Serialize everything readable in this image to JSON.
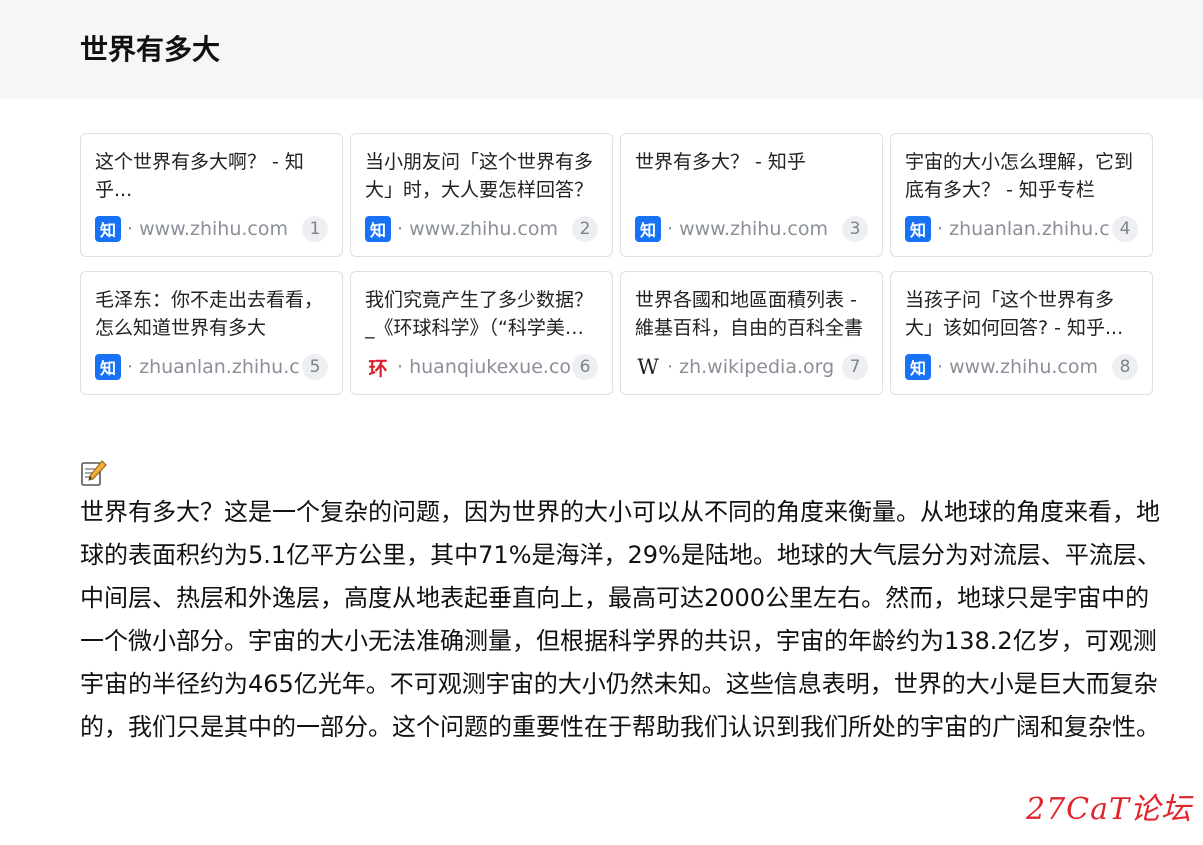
{
  "header": {
    "title": "世界有多大"
  },
  "sources": [
    {
      "title": "这个世界有多大啊？ - 知乎...",
      "favicon": "知",
      "favicon_kind": "zhihu",
      "domain": "www.zhihu.com",
      "index": "1"
    },
    {
      "title": "当小朋友问「这个世界有多大」时，大人要怎样回答？",
      "favicon": "知",
      "favicon_kind": "zhihu",
      "domain": "www.zhihu.com",
      "index": "2"
    },
    {
      "title": "世界有多大？ - 知乎",
      "favicon": "知",
      "favicon_kind": "zhihu",
      "domain": "www.zhihu.com",
      "index": "3"
    },
    {
      "title": "宇宙的大小怎么理解，它到底有多大？ - 知乎专栏",
      "favicon": "知",
      "favicon_kind": "zhihu",
      "domain": "zhuanlan.zhihu.com",
      "index": "4"
    },
    {
      "title": "毛泽东：你不走出去看看，怎么知道世界有多大",
      "favicon": "知",
      "favicon_kind": "zhihu",
      "domain": "zhuanlan.zhihu.com",
      "index": "5"
    },
    {
      "title": "我们究竟产生了多少数据？_《环球科学》（“科学美国人”中文版）",
      "favicon": "环",
      "favicon_kind": "huanqiu",
      "domain": "huanqiukexue.com",
      "index": "6"
    },
    {
      "title": "世界各國和地區面積列表 - 維基百科，自由的百科全書",
      "favicon": "W",
      "favicon_kind": "wiki",
      "domain": "zh.wikipedia.org",
      "index": "7"
    },
    {
      "title": "当孩子问「这个世界有多大」该如何回答? - 知乎...",
      "favicon": "知",
      "favicon_kind": "zhihu",
      "domain": "www.zhihu.com",
      "index": "8"
    }
  ],
  "answer": {
    "icon": "memo-icon",
    "text": "世界有多大？这是一个复杂的问题，因为世界的大小可以从不同的角度来衡量。从地球的角度来看，地球的表面积约为5.1亿平方公里，其中71%是海洋，29%是陆地。地球的大气层分为对流层、平流层、中间层、热层和外逸层，高度从地表起垂直向上，最高可达2000公里左右。然而，地球只是宇宙中的一个微小部分。宇宙的大小无法准确测量，但根据科学界的共识，宇宙的年龄约为138.2亿岁，可观测宇宙的半径约为465亿光年。不可观测宇宙的大小仍然未知。这些信息表明，世界的大小是巨大而复杂的，我们只是其中的一部分。这个问题的重要性在于帮助我们认识到我们所处的宇宙的广阔和复杂性。"
  },
  "watermark": "27CaT论坛",
  "colors": {
    "zhihu": "#1772f6",
    "huanqiu": "#d8202f",
    "watermark": "#e0262b",
    "header_bg": "#f5f6f7"
  }
}
